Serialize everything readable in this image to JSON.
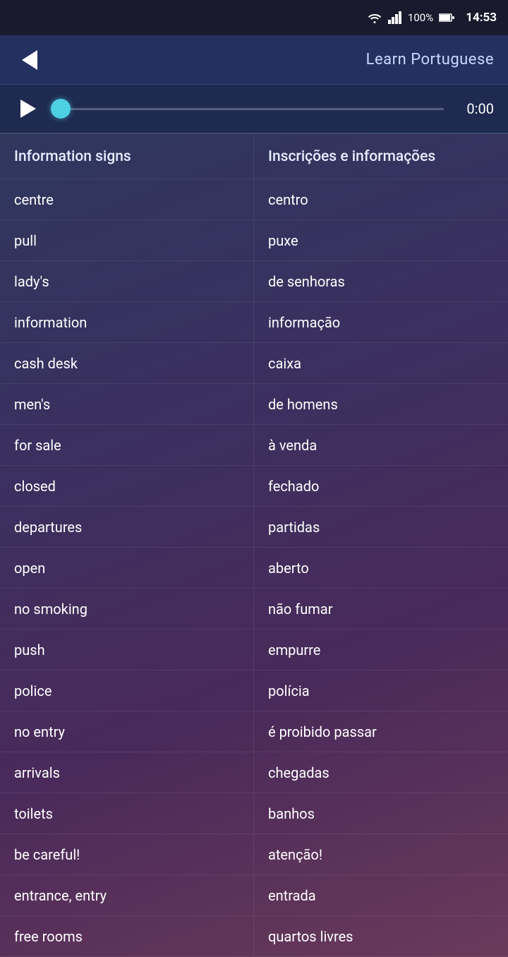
{
  "statusBar": {
    "wifi": "wifi",
    "signal": "signal",
    "battery": "100%",
    "time": "14:53"
  },
  "header": {
    "backLabel": "←",
    "title": "Learn Portuguese"
  },
  "audioPlayer": {
    "playButton": "▶",
    "time": "0:00"
  },
  "columns": {
    "left": "Information signs",
    "right": "Inscrições e informações"
  },
  "rows": [
    {
      "english": "centre",
      "portuguese": "centro"
    },
    {
      "english": "pull",
      "portuguese": "puxe"
    },
    {
      "english": "lady's",
      "portuguese": "de senhoras"
    },
    {
      "english": "information",
      "portuguese": "informação"
    },
    {
      "english": "cash desk",
      "portuguese": "caixa"
    },
    {
      "english": "men's",
      "portuguese": "de homens"
    },
    {
      "english": "for sale",
      "portuguese": "à venda"
    },
    {
      "english": "closed",
      "portuguese": "fechado"
    },
    {
      "english": "departures",
      "portuguese": "partidas"
    },
    {
      "english": "open",
      "portuguese": "aberto"
    },
    {
      "english": "no smoking",
      "portuguese": "não fumar"
    },
    {
      "english": "push",
      "portuguese": "empurre"
    },
    {
      "english": "police",
      "portuguese": "polícia"
    },
    {
      "english": "no entry",
      "portuguese": "é proibido passar"
    },
    {
      "english": "arrivals",
      "portuguese": "chegadas"
    },
    {
      "english": "toilets",
      "portuguese": "banhos"
    },
    {
      "english": "be careful!",
      "portuguese": "atenção!"
    },
    {
      "english": "entrance, entry",
      "portuguese": "entrada"
    },
    {
      "english": "free rooms",
      "portuguese": "quartos livres"
    }
  ]
}
